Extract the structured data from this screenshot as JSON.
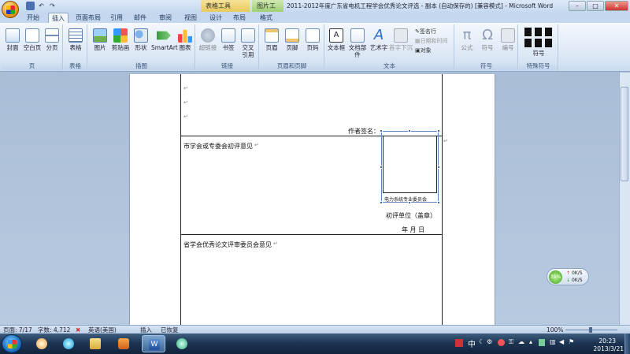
{
  "window": {
    "title": "2011-2012年度广东省电机工程学会优秀论文评选 - 副本 (自动保存的) [兼容模式] - Microsoft Word",
    "context_tabs": [
      "表格工具",
      "图片工具"
    ],
    "controls": {
      "minimize": "–",
      "maximize": "□",
      "close": "✕"
    }
  },
  "tabs": [
    "开始",
    "插入",
    "页面布局",
    "引用",
    "邮件",
    "审阅",
    "视图",
    "设计",
    "布局",
    "格式"
  ],
  "active_tab": "插入",
  "ribbon": {
    "groups": [
      {
        "label": "页",
        "buttons": [
          "封面",
          "空白页",
          "分页"
        ]
      },
      {
        "label": "表格",
        "buttons": [
          "表格"
        ]
      },
      {
        "label": "插图",
        "buttons": [
          "图片",
          "剪贴画",
          "形状",
          "SmartArt",
          "图表"
        ]
      },
      {
        "label": "链接",
        "buttons": [
          "超链接",
          "书签",
          "交叉引用"
        ]
      },
      {
        "label": "页眉和页脚",
        "buttons": [
          "页眉",
          "页脚",
          "页码"
        ]
      },
      {
        "label": "文本",
        "buttons": [
          "文本框",
          "文档部件",
          "艺术字",
          "首字下沉"
        ],
        "small": [
          "签名行",
          "日期和时间",
          "对象"
        ]
      },
      {
        "label": "符号",
        "buttons": [
          "公式",
          "符号",
          "编号"
        ]
      },
      {
        "label": "特殊符号",
        "buttons": [
          "符号"
        ]
      }
    ]
  },
  "document": {
    "author_signature": "作者签名：",
    "city_opinion": "市学会或专委会初评意见",
    "seal_text": "电力系统专业委员会",
    "review_unit": "初评单位（盖章）",
    "date_row": "年    月    日",
    "province_opinion": "省学会优秀论文评审委员会意见"
  },
  "status": {
    "page": "页面: 7/17",
    "words": "字数: 4,712",
    "language": "英语(美国)",
    "insert_mode": "插入",
    "restored": "已恢复",
    "zoom": "100%"
  },
  "taskbar": {
    "clock_time": "20:23",
    "clock_date": "2013/3/21",
    "ime": "中"
  },
  "net_widget": {
    "percent": "35%",
    "up": "0K/S",
    "down": "0K/S"
  }
}
